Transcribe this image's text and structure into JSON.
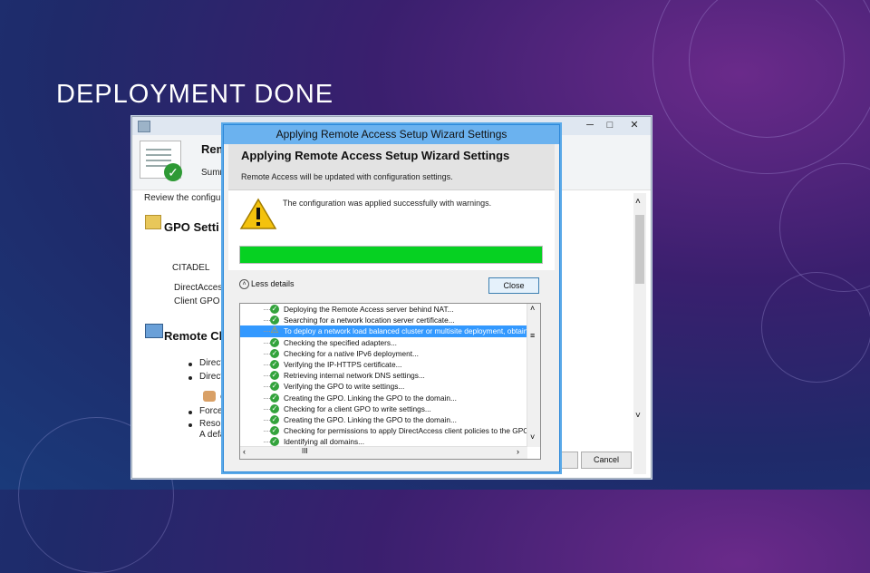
{
  "slide": {
    "title": "DEPLOYMENT DONE"
  },
  "background_window": {
    "controls": {
      "minimize": "─",
      "maximize": "□",
      "close": "✕"
    },
    "header_title": "Rem",
    "header_subtitle": "Summ",
    "review_text": "Review the configur",
    "gpo_section_title": "GPO Setti",
    "server_name": "CITADEL",
    "directaccess_line": "DirectAccess",
    "client_gpo_line": "Client GPO n",
    "remote_clients_title": "Remote Cl",
    "bullets": [
      "Direct",
      "Direct"
    ],
    "group_label": "C",
    "bullets2": [
      "Force",
      "Resou"
    ],
    "footer_partial": "A defa",
    "cancel_label": "Cancel"
  },
  "dialog": {
    "title": "Applying Remote Access Setup Wizard Settings",
    "banner_title": "Applying Remote Access Setup Wizard Settings",
    "banner_subtitle": "Remote Access will be updated with configuration settings.",
    "message": "The configuration was applied successfully with warnings.",
    "progress": 1.0,
    "progress_color": "#06d122",
    "less_details": "Less details",
    "close_label": "Close",
    "rows": [
      {
        "text": "Deploying the Remote Access server behind NAT...",
        "status": "ok"
      },
      {
        "text": "Searching for a network location server certificate...",
        "status": "ok"
      },
      {
        "text": "To deploy a network load balanced cluster or multisite deployment, obtain a",
        "status": "warning",
        "selected": true
      },
      {
        "text": "Checking the specified adapters...",
        "status": "ok"
      },
      {
        "text": "Checking for a native IPv6 deployment...",
        "status": "ok"
      },
      {
        "text": "Verifying the IP-HTTPS certificate...",
        "status": "ok"
      },
      {
        "text": "Retrieving internal network DNS settings...",
        "status": "ok"
      },
      {
        "text": "Verifying the GPO to write settings...",
        "status": "ok"
      },
      {
        "text": "Creating the GPO. Linking the GPO to the domain...",
        "status": "ok"
      },
      {
        "text": "Checking for a client GPO to write settings...",
        "status": "ok"
      },
      {
        "text": "Creating the GPO. Linking the GPO to the domain...",
        "status": "ok"
      },
      {
        "text": "Checking for permissions to apply DirectAccess client policies to the GPO...",
        "status": "ok"
      },
      {
        "text": "Identifying all domains...",
        "status": "ok"
      }
    ],
    "hscroll_thumb": "III"
  }
}
